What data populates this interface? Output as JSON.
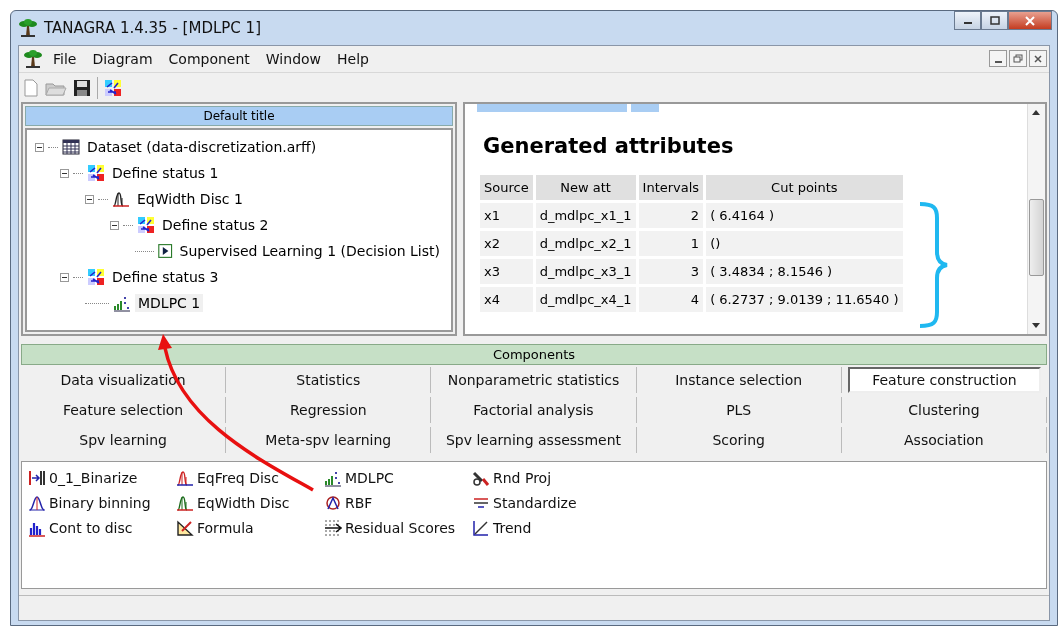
{
  "window": {
    "title": "TANAGRA 1.4.35 - [MDLPC 1]"
  },
  "menu": [
    "File",
    "Diagram",
    "Component",
    "Window",
    "Help"
  ],
  "diagram": {
    "title": "Default title",
    "tree": [
      {
        "label": "Dataset (data-discretization.arff)",
        "kind": "dataset",
        "expanded": true,
        "children": [
          {
            "label": "Define status 1",
            "kind": "status",
            "expanded": true,
            "children": [
              {
                "label": "EqWidth Disc 1",
                "kind": "disc",
                "expanded": true,
                "children": [
                  {
                    "label": "Define status 2",
                    "kind": "status",
                    "expanded": true,
                    "children": [
                      {
                        "label": "Supervised Learning 1 (Decision List)",
                        "kind": "learning",
                        "selected": false
                      }
                    ]
                  }
                ]
              }
            ]
          },
          {
            "label": "Define status 3",
            "kind": "status",
            "expanded": true,
            "children": [
              {
                "label": "MDLPC 1",
                "kind": "mdlpc",
                "selected": true
              }
            ]
          }
        ]
      }
    ]
  },
  "report": {
    "heading": "Generated attributes",
    "columns": [
      "Source",
      "New att",
      "Intervals",
      "Cut points"
    ],
    "rows": [
      [
        "x1",
        "d_mdlpc_x1_1",
        "2",
        "( 6.4164 )"
      ],
      [
        "x2",
        "d_mdlpc_x2_1",
        "1",
        "()"
      ],
      [
        "x3",
        "d_mdlpc_x3_1",
        "3",
        "( 3.4834 ; 8.1546 )"
      ],
      [
        "x4",
        "d_mdlpc_x4_1",
        "4",
        "( 6.2737 ; 9.0139 ; 11.6540 )"
      ]
    ]
  },
  "components": {
    "title": "Components",
    "tabs": [
      {
        "label": "Data visualization",
        "selected": false
      },
      {
        "label": "Statistics",
        "selected": false
      },
      {
        "label": "Nonparametric statistics",
        "selected": false
      },
      {
        "label": "Instance selection",
        "selected": false
      },
      {
        "label": "Feature construction",
        "selected": true
      },
      {
        "label": "Feature selection",
        "selected": false
      },
      {
        "label": "Regression",
        "selected": false
      },
      {
        "label": "Factorial analysis",
        "selected": false
      },
      {
        "label": "PLS",
        "selected": false
      },
      {
        "label": "Clustering",
        "selected": false
      },
      {
        "label": "Spv learning",
        "selected": false
      },
      {
        "label": "Meta-spv learning",
        "selected": false
      },
      {
        "label": "Spv learning assessment",
        "selected": false
      },
      {
        "label": "Scoring",
        "selected": false
      },
      {
        "label": "Association",
        "selected": false
      }
    ],
    "items": [
      {
        "label": "0_1_Binarize",
        "kind": "binarize"
      },
      {
        "label": "Binary binning",
        "kind": "binning"
      },
      {
        "label": "Cont to disc",
        "kind": "bars"
      },
      {
        "label": "EqFreq Disc",
        "kind": "disc"
      },
      {
        "label": "EqWidth Disc",
        "kind": "discgreen"
      },
      {
        "label": "Formula",
        "kind": "formula"
      },
      {
        "label": "MDLPC",
        "kind": "mdlpc"
      },
      {
        "label": "RBF",
        "kind": "rbf"
      },
      {
        "label": "Residual Scores",
        "kind": "residual"
      },
      {
        "label": "Rnd Proj",
        "kind": "proj"
      },
      {
        "label": "Standardize",
        "kind": "standardize"
      },
      {
        "label": "Trend",
        "kind": "trend"
      }
    ]
  }
}
